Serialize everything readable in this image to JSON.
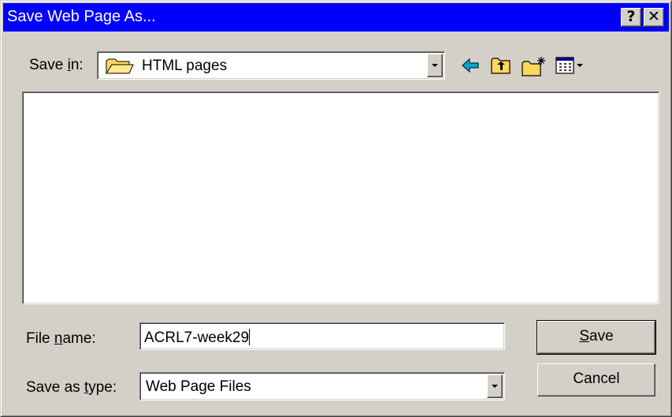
{
  "window": {
    "title": "Save Web Page As...",
    "help_label": "?",
    "close_label": "✕"
  },
  "save_in": {
    "label_pre": "Save ",
    "label_accel": "i",
    "label_post": "n:",
    "value": "HTML pages",
    "icon": "folder-icon"
  },
  "toolbar": {
    "icons": [
      "back-arrow-icon",
      "up-one-level-icon",
      "new-folder-icon",
      "views-menu-icon"
    ]
  },
  "file_list": {
    "items": []
  },
  "file_name": {
    "label_pre": "File ",
    "label_accel": "n",
    "label_post": "ame:",
    "value": "ACRL7-week29"
  },
  "save_as_type": {
    "label_pre": "Save as ",
    "label_accel": "t",
    "label_post": "ype:",
    "value": "Web Page Files"
  },
  "buttons": {
    "save_accel": "S",
    "save_rest": "ave",
    "cancel": "Cancel"
  },
  "colors": {
    "titlebar": "#0000ff",
    "face": "#d4d0c8",
    "folder": "#ffd75a",
    "back_arrow": "#00a8c8"
  }
}
